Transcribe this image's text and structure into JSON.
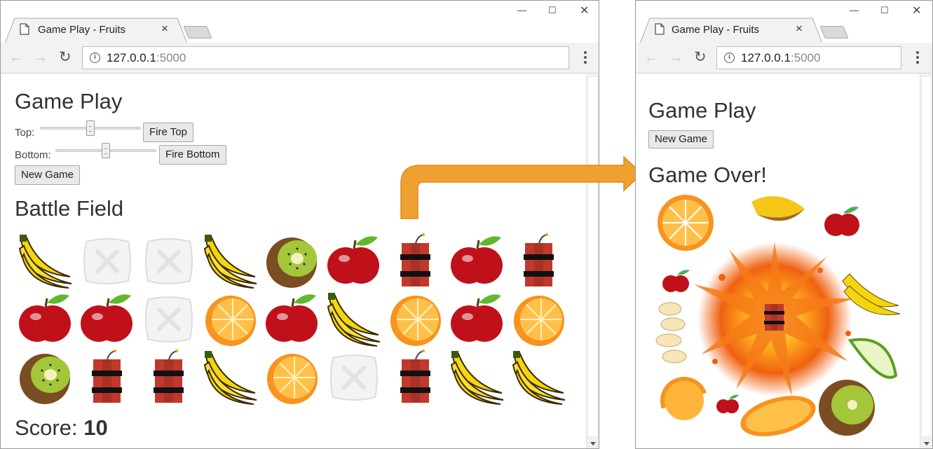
{
  "left_window": {
    "tab": {
      "title": "Game Play - Fruits",
      "close": "×"
    },
    "url": {
      "host": "127.0.0.1",
      "port": ":5000"
    },
    "page": {
      "title": "Game Play",
      "top_label": "Top:",
      "top_slider_value": 0.5,
      "fire_top": "Fire Top",
      "bottom_label": "Bottom:",
      "bottom_slider_value": 0.5,
      "fire_bottom": "Fire Bottom",
      "new_game": "New Game",
      "battlefield_title": "Battle Field",
      "grid": [
        [
          "banana",
          "empty",
          "empty",
          "banana",
          "kiwi",
          "apple",
          "dynamite",
          "apple",
          "dynamite"
        ],
        [
          "apple",
          "apple",
          "empty",
          "orange",
          "apple",
          "banana",
          "orange",
          "apple",
          "orange"
        ],
        [
          "kiwi",
          "dynamite",
          "dynamite",
          "banana",
          "orange",
          "empty",
          "dynamite",
          "banana",
          "banana"
        ]
      ],
      "score_label": "Score:",
      "score_value": "10"
    }
  },
  "right_window": {
    "tab": {
      "title": "Game Play - Fruits",
      "close": "×"
    },
    "url": {
      "host": "127.0.0.1",
      "port": ":5000"
    },
    "page": {
      "title": "Game Play",
      "new_game": "New Game",
      "game_over": "Game Over!"
    }
  },
  "colors": {
    "arrow": "#f0a030",
    "arrow_stroke": "#d98c1a"
  }
}
